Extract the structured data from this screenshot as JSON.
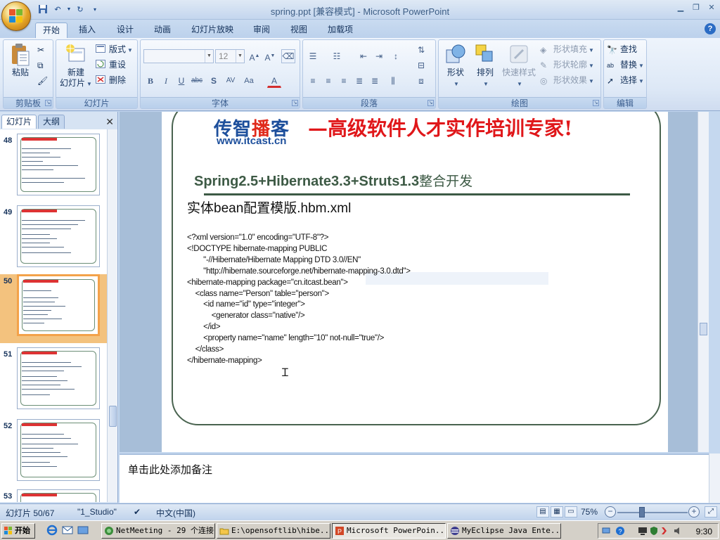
{
  "window": {
    "title": "spring.ppt [兼容模式] - Microsoft PowerPoint"
  },
  "ribbon_tabs": [
    "开始",
    "插入",
    "设计",
    "动画",
    "幻灯片放映",
    "审阅",
    "视图",
    "加载项"
  ],
  "ribbon": {
    "clipboard": {
      "label": "剪贴板",
      "paste": "粘贴"
    },
    "slides": {
      "label": "幻灯片",
      "new_slide_line1": "新建",
      "new_slide_line2": "幻灯片",
      "layout": "版式",
      "reset": "重设",
      "delete": "删除"
    },
    "font": {
      "label": "字体",
      "size": "12"
    },
    "paragraph": {
      "label": "段落"
    },
    "drawing": {
      "label": "绘图",
      "shapes": "形状",
      "arrange": "排列",
      "quick_styles": "快速样式",
      "shape_fill": "形状填充",
      "shape_outline": "形状轮廓",
      "shape_effects": "形状效果"
    },
    "editing": {
      "label": "编辑",
      "find": "查找",
      "replace": "替换",
      "select": "选择"
    }
  },
  "left_panel": {
    "tabs": [
      "幻灯片",
      "大纲"
    ],
    "slide_numbers": [
      "48",
      "49",
      "50",
      "51",
      "52",
      "53"
    ],
    "selected": "50"
  },
  "slide": {
    "logo_part1": "传智",
    "logo_part2": "播",
    "logo_part3": "客",
    "logo_url": "www.itcast.cn",
    "slogan": "—高级软件人才实作培训专家!",
    "subject_latin": "Spring2.5+Hibernate3.3+Struts1.3",
    "subject_cn": "整合开发",
    "heading": "实体bean配置模版.hbm.xml",
    "code_lines": [
      "<?xml version=\"1.0\" encoding=\"UTF-8\"?>",
      "<!DOCTYPE hibernate-mapping PUBLIC",
      "        \"-//Hibernate/Hibernate Mapping DTD 3.0//EN\"",
      "        \"http://hibernate.sourceforge.net/hibernate-mapping-3.0.dtd\">",
      "<hibernate-mapping package=\"cn.itcast.bean\">",
      "    <class name=\"Person\" table=\"person\">",
      "        <id name=\"id\" type=\"integer\">",
      "            <generator class=\"native\"/>",
      "        </id>",
      "        <property name=\"name\" length=\"10\" not-null=\"true\"/>",
      "    </class>",
      "</hibernate-mapping>"
    ]
  },
  "notes": {
    "placeholder": "单击此处添加备注"
  },
  "status": {
    "slide_counter": "幻灯片 50/67",
    "theme": "\"1_Studio\"",
    "language": "中文(中国)",
    "zoom": "75%"
  },
  "taskbar": {
    "start": "开始",
    "tasks": [
      "NetMeeting - 29 个连接",
      "E:\\opensoftlib\\hibe...",
      "Microsoft PowerPoin...",
      "MyEclipse Java Ente..."
    ],
    "clock": "9:30"
  }
}
